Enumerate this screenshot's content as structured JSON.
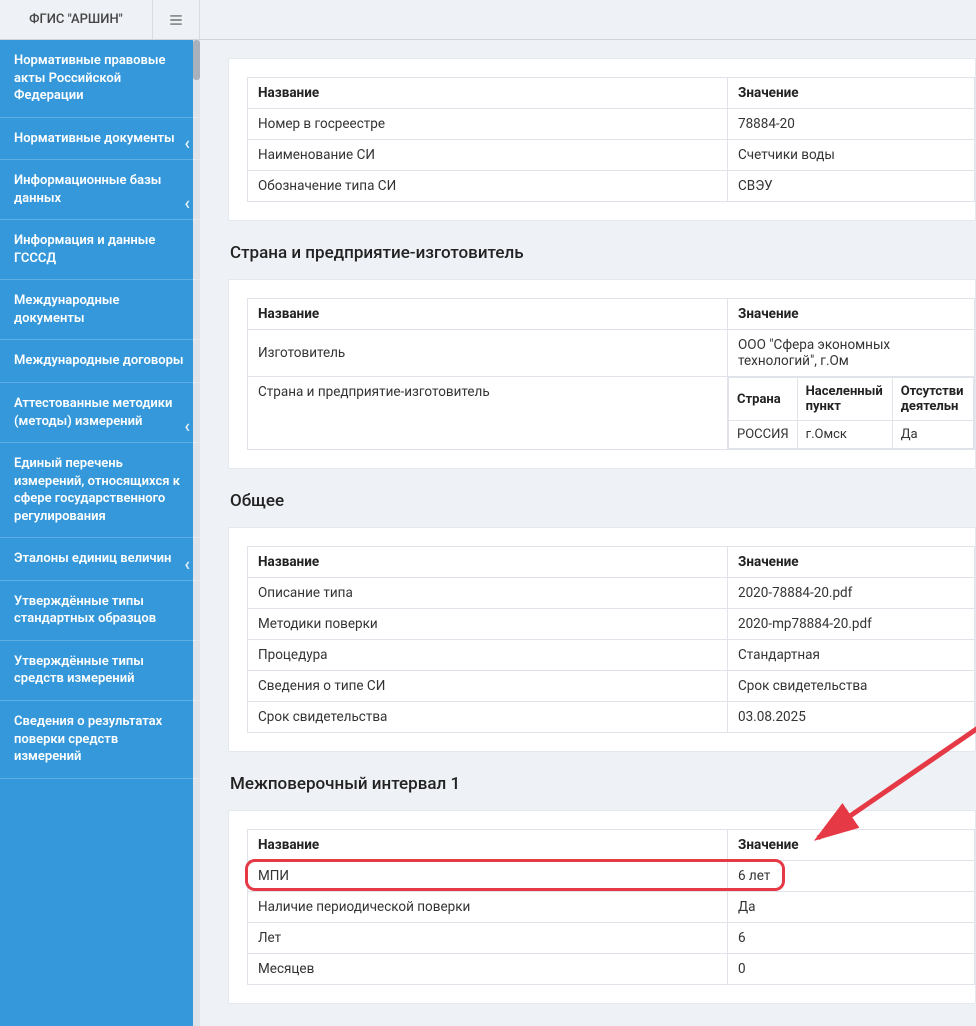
{
  "app": {
    "title": "ФГИС \"АРШИН\""
  },
  "sidebar": {
    "items": [
      {
        "label": "Нормативные правовые акты Российской Федерации",
        "chevron": false
      },
      {
        "label": "Нормативные документы",
        "chevron": true
      },
      {
        "label": "Информационные базы данных",
        "chevron": true
      },
      {
        "label": "Информация и данные ГСССД",
        "chevron": false
      },
      {
        "label": "Международные документы",
        "chevron": false
      },
      {
        "label": "Международные договоры",
        "chevron": false
      },
      {
        "label": "Аттестованные методики (методы) измерений",
        "chevron": true
      },
      {
        "label": "Единый перечень измерений, относящихся к сфере государственного регулирования",
        "chevron": false
      },
      {
        "label": "Эталоны единиц величин",
        "chevron": true
      },
      {
        "label": "Утверждённые типы стандартных образцов",
        "chevron": false
      },
      {
        "label": "Утверждённые типы средств измерений",
        "chevron": false
      },
      {
        "label": "Сведения о результатах поверки средств измерений",
        "chevron": false
      }
    ]
  },
  "tables": {
    "col_name": "Название",
    "col_value": "Значение",
    "section1": {
      "rows": [
        {
          "name": "Номер в госреестре",
          "value": "78884-20"
        },
        {
          "name": "Наименование СИ",
          "value": "Счетчики воды"
        },
        {
          "name": "Обозначение типа СИ",
          "value": "СВЭУ"
        }
      ]
    },
    "section2": {
      "title": "Страна и предприятие-изготовитель",
      "rows": [
        {
          "name": "Изготовитель",
          "value": "ООО \"Сфера экономных технологий\", г.Ом"
        }
      ],
      "subrow_name": "Страна и предприятие-изготовитель",
      "inner": {
        "headers": {
          "country": "Страна",
          "locality": "Населенный пункт",
          "absence": "Отсутстви деятельн"
        },
        "row": {
          "country": "РОССИЯ",
          "locality": "г.Омск",
          "absence": "Да"
        }
      }
    },
    "section3": {
      "title": "Общее",
      "rows": [
        {
          "name": "Описание типа",
          "value": "2020-78884-20.pdf"
        },
        {
          "name": "Методики поверки",
          "value": "2020-mp78884-20.pdf"
        },
        {
          "name": "Процедура",
          "value": "Стандартная"
        },
        {
          "name": "Сведения о типе СИ",
          "value": "Срок свидетельства"
        },
        {
          "name": "Срок свидетельства",
          "value": "03.08.2025"
        }
      ]
    },
    "section4": {
      "title": "Межповерочный интервал 1",
      "rows": [
        {
          "name": "МПИ",
          "value": "6 лет"
        },
        {
          "name": "Наличие периодической поверки",
          "value": "Да"
        },
        {
          "name": "Лет",
          "value": "6"
        },
        {
          "name": "Месяцев",
          "value": "0"
        }
      ]
    }
  }
}
